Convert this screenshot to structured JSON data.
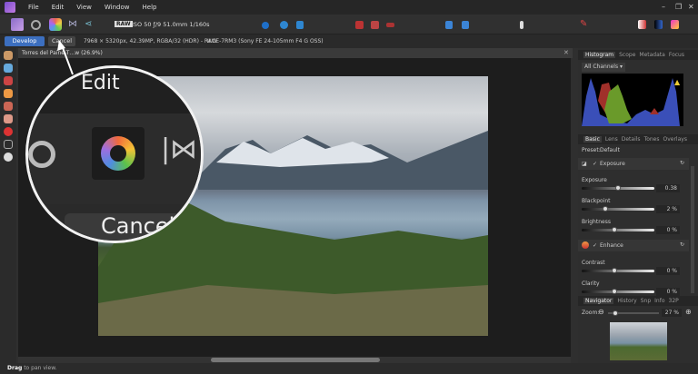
{
  "menu": {
    "items": [
      "File",
      "Edit",
      "View",
      "Window",
      "Help"
    ]
  },
  "toolbar": {
    "raw_badge": "RAW",
    "exif": "ISO 50 ƒ/9 51.0mm 1/160s"
  },
  "context": {
    "develop": "Develop",
    "cancel": "Cancel",
    "image_info": "7968 × 5320px, 42.39MP, RGBA/32 (HDR) - RAW",
    "camera_info": "ILCE-7RM3 (Sony FE 24-105mm F4 G OSS)"
  },
  "document": {
    "tab_title": "Torres del Paine-T…w (26.9%)"
  },
  "magnifier": {
    "edit_label": "Edit",
    "cancel_label": "Cancel"
  },
  "status": {
    "bold": "Drag",
    "rest": " to pan view."
  },
  "histogram_panel": {
    "tabs": [
      "Histogram",
      "Scope",
      "Metadata",
      "Focus"
    ],
    "channel": "All Channels"
  },
  "basic_panel": {
    "tabs": [
      "Basic",
      "Lens",
      "Details",
      "Tones",
      "Overlays"
    ],
    "preset_label": "Preset:",
    "preset_value": "Default",
    "exposure_section": "Exposure",
    "enhance_section": "Enhance",
    "sliders": [
      {
        "label": "Exposure",
        "value": "0.38",
        "pos": 0.5
      },
      {
        "label": "Blackpoint",
        "value": "2 %",
        "pos": 0.33
      },
      {
        "label": "Brightness",
        "value": "0 %",
        "pos": 0.45
      },
      {
        "label": "Contrast",
        "value": "0 %",
        "pos": 0.45
      },
      {
        "label": "Clarity",
        "value": "0 %",
        "pos": 0.45
      }
    ]
  },
  "navigator_panel": {
    "tabs": [
      "Navigator",
      "History",
      "Snp",
      "Info",
      "32P"
    ],
    "zoom_label": "Zoom:",
    "zoom_value": "27 %"
  }
}
